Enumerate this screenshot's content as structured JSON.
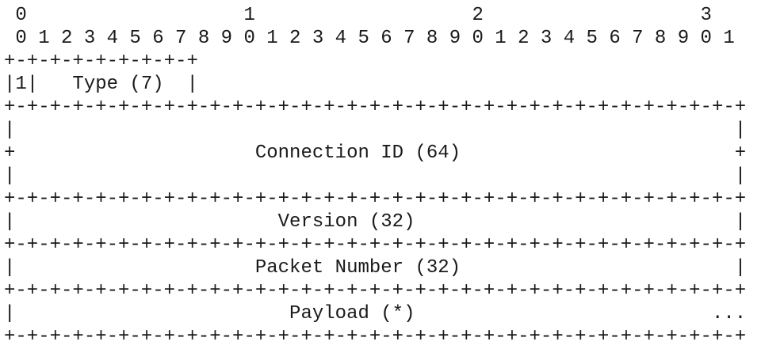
{
  "diagram": {
    "lines": [
      " 0                   1                   2                   3",
      " 0 1 2 3 4 5 6 7 8 9 0 1 2 3 4 5 6 7 8 9 0 1 2 3 4 5 6 7 8 9 0 1",
      "+-+-+-+-+-+-+-+-+",
      "|1|   Type (7)  |",
      "+-+-+-+-+-+-+-+-+-+-+-+-+-+-+-+-+-+-+-+-+-+-+-+-+-+-+-+-+-+-+-+-+",
      "|                                                               |",
      "+                     Connection ID (64)                        +",
      "|                                                               |",
      "+-+-+-+-+-+-+-+-+-+-+-+-+-+-+-+-+-+-+-+-+-+-+-+-+-+-+-+-+-+-+-+-+",
      "|                       Version (32)                            |",
      "+-+-+-+-+-+-+-+-+-+-+-+-+-+-+-+-+-+-+-+-+-+-+-+-+-+-+-+-+-+-+-+-+",
      "|                     Packet Number (32)                        |",
      "+-+-+-+-+-+-+-+-+-+-+-+-+-+-+-+-+-+-+-+-+-+-+-+-+-+-+-+-+-+-+-+-+",
      "|                        Payload (*)                          ...",
      "+-+-+-+-+-+-+-+-+-+-+-+-+-+-+-+-+-+-+-+-+-+-+-+-+-+-+-+-+-+-+-+-+"
    ]
  }
}
